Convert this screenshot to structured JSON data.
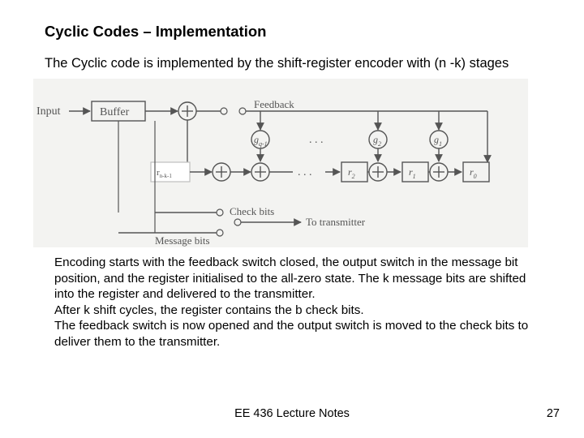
{
  "title": "Cyclic Codes – Implementation",
  "intro": "The Cyclic code is implemented by the shift-register encoder with (n -k) stages",
  "desc": "Encoding starts with the feedback switch closed, the output switch in the message bit position, and the register initialised to the all-zero state. The k message bits are shifted into the register and delivered to the transmitter.\nAfter k shift cycles, the register contains the b check bits.\nThe feedback switch is now opened and the output switch is moved to the check bits to deliver them to the transmitter.",
  "footer_center": "EE 436 Lecture Notes",
  "footer_page": "27",
  "diagram": {
    "input_label": "Input",
    "buffer_label": "Buffer",
    "feedback_label": "Feedback",
    "checkbits_label": "Check bits",
    "msgbits_label": "Message bits",
    "to_tx_label": "To transmitter",
    "r_nk1": "r",
    "r_nk1_sub": "n-k-1",
    "r2_label": "r",
    "r2_sub": "2",
    "r1_label": "r",
    "r1_sub": "1",
    "r0_label": "r",
    "r0_sub": "0",
    "gq1_label": "g",
    "gq1_sub": "q-1",
    "g2_label": "g",
    "g2_sub": "2",
    "g1_label": "g",
    "g1_sub": "1"
  }
}
